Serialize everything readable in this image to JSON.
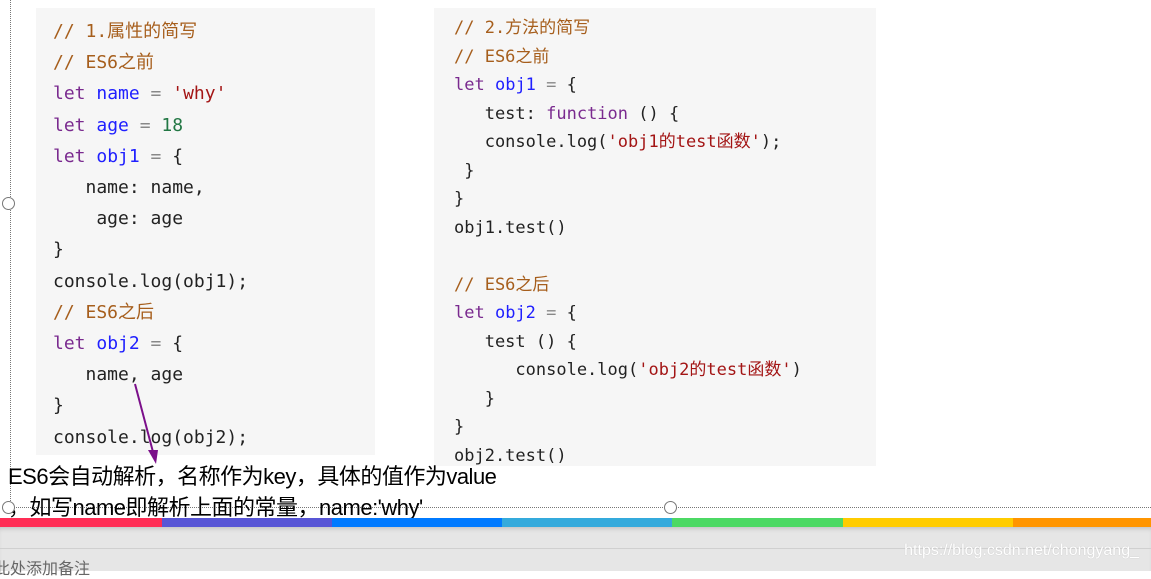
{
  "code_block_1": [
    [
      [
        "comment",
        "// 1.属性的简写"
      ]
    ],
    [
      [
        "comment",
        "// ES6之前"
      ]
    ],
    [
      [
        "kw",
        "let"
      ],
      [
        "plain",
        " "
      ],
      [
        "def",
        "name"
      ],
      [
        "op",
        " = "
      ],
      [
        "str",
        "'why'"
      ]
    ],
    [
      [
        "kw",
        "let"
      ],
      [
        "plain",
        " "
      ],
      [
        "def",
        "age"
      ],
      [
        "op",
        " = "
      ],
      [
        "num",
        "18"
      ]
    ],
    [
      [
        "kw",
        "let"
      ],
      [
        "plain",
        " "
      ],
      [
        "def",
        "obj1"
      ],
      [
        "op",
        " = "
      ],
      [
        "plain",
        "{"
      ]
    ],
    [
      [
        "plain",
        "   name: name,"
      ]
    ],
    [
      [
        "plain",
        "    age: age"
      ]
    ],
    [
      [
        "plain",
        "}"
      ]
    ],
    [
      [
        "plain",
        "console.log(obj1);"
      ]
    ],
    [
      [
        "comment",
        "// ES6之后"
      ]
    ],
    [
      [
        "kw",
        "let"
      ],
      [
        "plain",
        " "
      ],
      [
        "def",
        "obj2"
      ],
      [
        "op",
        " = "
      ],
      [
        "plain",
        "{"
      ]
    ],
    [
      [
        "plain",
        "   name, age"
      ]
    ],
    [
      [
        "plain",
        "}"
      ]
    ],
    [
      [
        "plain",
        "console.log(obj2);"
      ]
    ]
  ],
  "code_block_2": [
    [
      [
        "comment",
        "// 2.方法的简写"
      ]
    ],
    [
      [
        "comment",
        "// ES6之前"
      ]
    ],
    [
      [
        "kw",
        "let"
      ],
      [
        "plain",
        " "
      ],
      [
        "def",
        "obj1"
      ],
      [
        "op",
        " = "
      ],
      [
        "plain",
        "{"
      ]
    ],
    [
      [
        "plain",
        "   test: "
      ],
      [
        "kw",
        "function"
      ],
      [
        "plain",
        " () {"
      ]
    ],
    [
      [
        "plain",
        "   console.log("
      ],
      [
        "str",
        "'obj1的test函数'"
      ],
      [
        "plain",
        ");"
      ]
    ],
    [
      [
        "plain",
        " }"
      ]
    ],
    [
      [
        "plain",
        "}"
      ]
    ],
    [
      [
        "plain",
        "obj1.test()"
      ]
    ],
    [
      [
        "plain",
        ""
      ]
    ],
    [
      [
        "comment",
        "// ES6之后"
      ]
    ],
    [
      [
        "kw",
        "let"
      ],
      [
        "plain",
        " "
      ],
      [
        "def",
        "obj2"
      ],
      [
        "op",
        " = "
      ],
      [
        "plain",
        "{"
      ]
    ],
    [
      [
        "plain",
        "   test () {"
      ]
    ],
    [
      [
        "plain",
        "      console.log("
      ],
      [
        "str",
        "'obj2的test函数'"
      ],
      [
        "plain",
        ")"
      ]
    ],
    [
      [
        "plain",
        "   }"
      ]
    ],
    [
      [
        "plain",
        "}"
      ]
    ],
    [
      [
        "plain",
        "obj2.test()"
      ]
    ]
  ],
  "annotation": {
    "line1": "ES6会自动解析，名称作为key，具体的值作为value",
    "line2": "，如写name即解析上面的常量，name:'why'",
    "arrow_color": "#7b0f8a"
  },
  "theme_bar": [
    "#ff2d55",
    "#5856d6",
    "#007aff",
    "#34aadc",
    "#4cd964",
    "#ffcc00",
    "#ff9500"
  ],
  "notes": {
    "placeholder": "此处添加备注"
  },
  "watermark": "https://blog.csdn.net/chongyang_"
}
